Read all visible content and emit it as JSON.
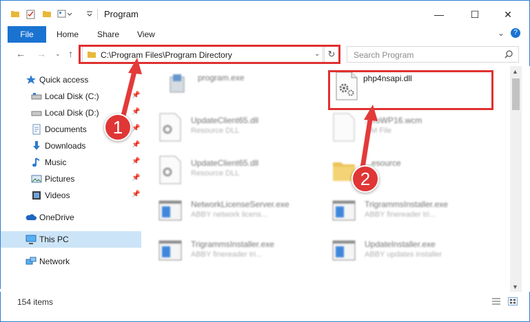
{
  "window": {
    "title": "Program",
    "minimize_glyph": "—",
    "maximize_glyph": "☐",
    "close_glyph": "✕"
  },
  "ribbon": {
    "file_tab": "File",
    "tabs": [
      "Home",
      "Share",
      "View"
    ],
    "expand_glyph": "⌄",
    "help_glyph": "?"
  },
  "navigation": {
    "address": "C:\\Program Files\\Program Directory",
    "search_placeholder": "Search Program"
  },
  "sidebar": {
    "items": [
      {
        "label": "Quick access",
        "icon": "star-icon",
        "pinned": false
      },
      {
        "label": "Local Disk (C:)",
        "icon": "drive-icon",
        "pinned": true
      },
      {
        "label": "Local Disk (D:)",
        "icon": "drive-icon",
        "pinned": true
      },
      {
        "label": "Documents",
        "icon": "documents-icon",
        "pinned": true
      },
      {
        "label": "Downloads",
        "icon": "downloads-icon",
        "pinned": true
      },
      {
        "label": "Music",
        "icon": "music-icon",
        "pinned": true
      },
      {
        "label": "Pictures",
        "icon": "pictures-icon",
        "pinned": true
      },
      {
        "label": "Videos",
        "icon": "videos-icon",
        "pinned": true
      },
      {
        "label": "OneDrive",
        "icon": "onedrive-icon",
        "pinned": false
      },
      {
        "label": "This PC",
        "icon": "computer-icon",
        "pinned": false,
        "selected": true
      },
      {
        "label": "Network",
        "icon": "network-icon",
        "pinned": false
      }
    ]
  },
  "files": [
    {
      "name": "program.exe",
      "sub": "",
      "icon": "installer-icon",
      "blurred": true
    },
    {
      "name": "php4nsapi.dll",
      "sub": "",
      "icon": "dll-gear-icon",
      "blurred": false
    },
    {
      "name": "UpdateClient65.dll",
      "sub": "Resource DLL",
      "icon": "dll-gear-icon",
      "blurred": true
    },
    {
      "name": "...ToWP16.wcm",
      "sub": "...M File",
      "icon": "blank-file-icon",
      "blurred": true
    },
    {
      "name": "UpdateClient65.dll",
      "sub": "Resource DLL",
      "icon": "dll-gear-icon",
      "blurred": true
    },
    {
      "name": "...esource",
      "sub": "",
      "icon": "folder-icon",
      "blurred": true
    },
    {
      "name": "NetworkLicenseServer.exe",
      "sub": "ABBY network licens...",
      "icon": "app-window-icon",
      "blurred": true
    },
    {
      "name": "TrigrammsInstaller.exe",
      "sub": "ABBY finereader tri...",
      "icon": "app-window-icon",
      "blurred": true
    },
    {
      "name": "TrigrammsInstaller.exe",
      "sub": "ABBY finereader tri...",
      "icon": "app-window-icon",
      "blurred": true
    },
    {
      "name": "UpdateInstaller.exe",
      "sub": "ABBY updates installer",
      "icon": "app-window-icon",
      "blurred": true
    }
  ],
  "status": {
    "item_count": "154 items"
  },
  "callouts": [
    "1",
    "2"
  ],
  "colors": {
    "accent": "#1a73d1",
    "highlight_red": "#e03030",
    "selection": "#cce4f7"
  }
}
